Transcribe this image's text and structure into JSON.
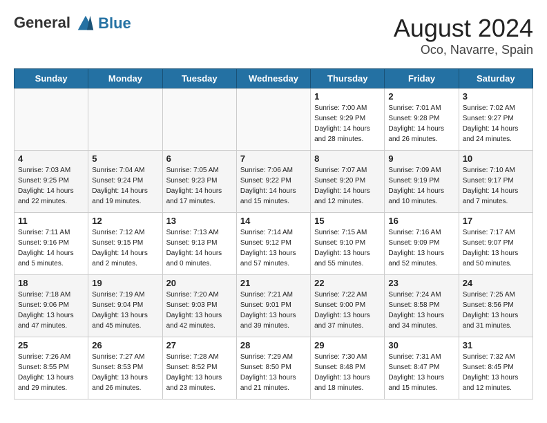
{
  "header": {
    "logo_line1": "General",
    "logo_line2": "Blue",
    "month_year": "August 2024",
    "location": "Oco, Navarre, Spain"
  },
  "weekdays": [
    "Sunday",
    "Monday",
    "Tuesday",
    "Wednesday",
    "Thursday",
    "Friday",
    "Saturday"
  ],
  "weeks": [
    [
      {
        "day": "",
        "info": ""
      },
      {
        "day": "",
        "info": ""
      },
      {
        "day": "",
        "info": ""
      },
      {
        "day": "",
        "info": ""
      },
      {
        "day": "1",
        "info": "Sunrise: 7:00 AM\nSunset: 9:29 PM\nDaylight: 14 hours\nand 28 minutes."
      },
      {
        "day": "2",
        "info": "Sunrise: 7:01 AM\nSunset: 9:28 PM\nDaylight: 14 hours\nand 26 minutes."
      },
      {
        "day": "3",
        "info": "Sunrise: 7:02 AM\nSunset: 9:27 PM\nDaylight: 14 hours\nand 24 minutes."
      }
    ],
    [
      {
        "day": "4",
        "info": "Sunrise: 7:03 AM\nSunset: 9:25 PM\nDaylight: 14 hours\nand 22 minutes."
      },
      {
        "day": "5",
        "info": "Sunrise: 7:04 AM\nSunset: 9:24 PM\nDaylight: 14 hours\nand 19 minutes."
      },
      {
        "day": "6",
        "info": "Sunrise: 7:05 AM\nSunset: 9:23 PM\nDaylight: 14 hours\nand 17 minutes."
      },
      {
        "day": "7",
        "info": "Sunrise: 7:06 AM\nSunset: 9:22 PM\nDaylight: 14 hours\nand 15 minutes."
      },
      {
        "day": "8",
        "info": "Sunrise: 7:07 AM\nSunset: 9:20 PM\nDaylight: 14 hours\nand 12 minutes."
      },
      {
        "day": "9",
        "info": "Sunrise: 7:09 AM\nSunset: 9:19 PM\nDaylight: 14 hours\nand 10 minutes."
      },
      {
        "day": "10",
        "info": "Sunrise: 7:10 AM\nSunset: 9:17 PM\nDaylight: 14 hours\nand 7 minutes."
      }
    ],
    [
      {
        "day": "11",
        "info": "Sunrise: 7:11 AM\nSunset: 9:16 PM\nDaylight: 14 hours\nand 5 minutes."
      },
      {
        "day": "12",
        "info": "Sunrise: 7:12 AM\nSunset: 9:15 PM\nDaylight: 14 hours\nand 2 minutes."
      },
      {
        "day": "13",
        "info": "Sunrise: 7:13 AM\nSunset: 9:13 PM\nDaylight: 14 hours\nand 0 minutes."
      },
      {
        "day": "14",
        "info": "Sunrise: 7:14 AM\nSunset: 9:12 PM\nDaylight: 13 hours\nand 57 minutes."
      },
      {
        "day": "15",
        "info": "Sunrise: 7:15 AM\nSunset: 9:10 PM\nDaylight: 13 hours\nand 55 minutes."
      },
      {
        "day": "16",
        "info": "Sunrise: 7:16 AM\nSunset: 9:09 PM\nDaylight: 13 hours\nand 52 minutes."
      },
      {
        "day": "17",
        "info": "Sunrise: 7:17 AM\nSunset: 9:07 PM\nDaylight: 13 hours\nand 50 minutes."
      }
    ],
    [
      {
        "day": "18",
        "info": "Sunrise: 7:18 AM\nSunset: 9:06 PM\nDaylight: 13 hours\nand 47 minutes."
      },
      {
        "day": "19",
        "info": "Sunrise: 7:19 AM\nSunset: 9:04 PM\nDaylight: 13 hours\nand 45 minutes."
      },
      {
        "day": "20",
        "info": "Sunrise: 7:20 AM\nSunset: 9:03 PM\nDaylight: 13 hours\nand 42 minutes."
      },
      {
        "day": "21",
        "info": "Sunrise: 7:21 AM\nSunset: 9:01 PM\nDaylight: 13 hours\nand 39 minutes."
      },
      {
        "day": "22",
        "info": "Sunrise: 7:22 AM\nSunset: 9:00 PM\nDaylight: 13 hours\nand 37 minutes."
      },
      {
        "day": "23",
        "info": "Sunrise: 7:24 AM\nSunset: 8:58 PM\nDaylight: 13 hours\nand 34 minutes."
      },
      {
        "day": "24",
        "info": "Sunrise: 7:25 AM\nSunset: 8:56 PM\nDaylight: 13 hours\nand 31 minutes."
      }
    ],
    [
      {
        "day": "25",
        "info": "Sunrise: 7:26 AM\nSunset: 8:55 PM\nDaylight: 13 hours\nand 29 minutes."
      },
      {
        "day": "26",
        "info": "Sunrise: 7:27 AM\nSunset: 8:53 PM\nDaylight: 13 hours\nand 26 minutes."
      },
      {
        "day": "27",
        "info": "Sunrise: 7:28 AM\nSunset: 8:52 PM\nDaylight: 13 hours\nand 23 minutes."
      },
      {
        "day": "28",
        "info": "Sunrise: 7:29 AM\nSunset: 8:50 PM\nDaylight: 13 hours\nand 21 minutes."
      },
      {
        "day": "29",
        "info": "Sunrise: 7:30 AM\nSunset: 8:48 PM\nDaylight: 13 hours\nand 18 minutes."
      },
      {
        "day": "30",
        "info": "Sunrise: 7:31 AM\nSunset: 8:47 PM\nDaylight: 13 hours\nand 15 minutes."
      },
      {
        "day": "31",
        "info": "Sunrise: 7:32 AM\nSunset: 8:45 PM\nDaylight: 13 hours\nand 12 minutes."
      }
    ]
  ]
}
